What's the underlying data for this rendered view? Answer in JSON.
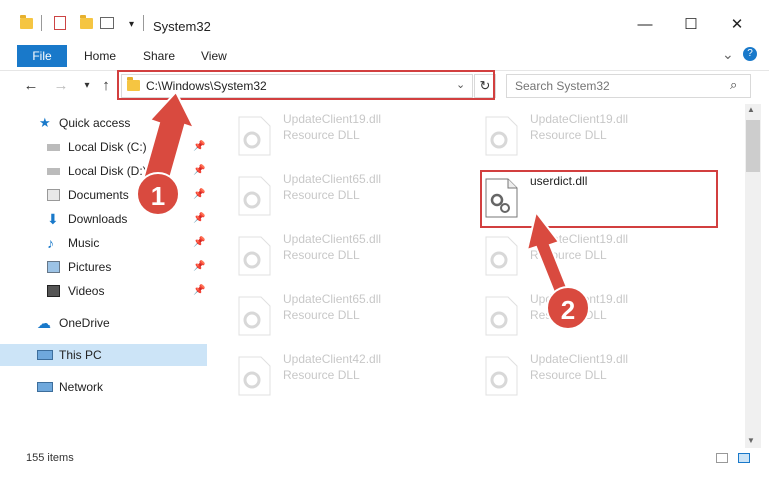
{
  "window": {
    "title": "System32",
    "minimize": "—",
    "maximize": "☐",
    "close": "✕"
  },
  "ribbon": {
    "file": "File",
    "tabs": [
      "Home",
      "Share",
      "View"
    ],
    "help_chevron": "⌄",
    "help": "?"
  },
  "address": {
    "path": "C:\\Windows\\System32",
    "search_placeholder": "Search System32"
  },
  "sidebar": {
    "items": [
      {
        "label": "Quick access",
        "icon": "star-icon"
      },
      {
        "label": "Local Disk (C:)",
        "icon": "drive-icon",
        "pinned": true
      },
      {
        "label": "Local Disk (D:)",
        "icon": "drive-icon",
        "pinned": true
      },
      {
        "label": "Documents",
        "icon": "documents-icon",
        "pinned": true
      },
      {
        "label": "Downloads",
        "icon": "downloads-icon",
        "pinned": true
      },
      {
        "label": "Music",
        "icon": "music-icon",
        "pinned": true
      },
      {
        "label": "Pictures",
        "icon": "pictures-icon",
        "pinned": true
      },
      {
        "label": "Videos",
        "icon": "videos-icon",
        "pinned": true
      },
      {
        "label": "OneDrive",
        "icon": "onedrive-icon"
      },
      {
        "label": "This PC",
        "icon": "pc-icon",
        "selected": true
      },
      {
        "label": "Network",
        "icon": "network-icon"
      }
    ]
  },
  "files": {
    "left": [
      {
        "name": "UpdateClient19.dll",
        "type": "Resource DLL"
      },
      {
        "name": "UpdateClient65.dll",
        "type": "Resource DLL"
      },
      {
        "name": "UpdateClient65.dll",
        "type": "Resource DLL"
      },
      {
        "name": "UpdateClient65.dll",
        "type": "Resource DLL"
      },
      {
        "name": "UpdateClient42.dll",
        "type": "Resource DLL"
      }
    ],
    "right": [
      {
        "name": "UpdateClient19.dll",
        "type": "Resource DLL"
      },
      {
        "name": "userdict.dll",
        "type": ""
      },
      {
        "name": "UpdateClient19.dll",
        "type": "Resource DLL"
      },
      {
        "name": "UpdateClient19.dll",
        "type": "Resource DLL"
      },
      {
        "name": "UpdateClient19.dll",
        "type": "Resource DLL"
      }
    ]
  },
  "status": {
    "count": "155 items"
  },
  "annotations": {
    "step1": "1",
    "step2": "2",
    "color": "#d94a3f"
  }
}
